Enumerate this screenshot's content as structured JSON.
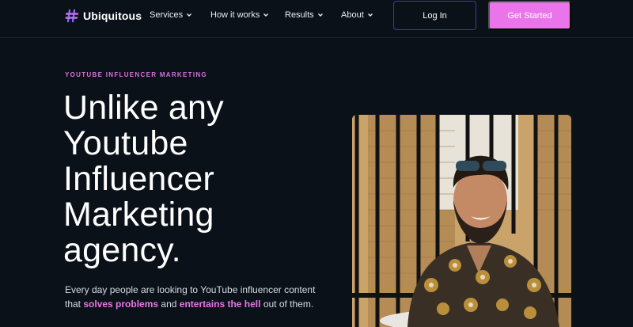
{
  "brand": {
    "name": "Ubiquitous",
    "logo_icon": "hash-icon",
    "accent": "#ea75ea"
  },
  "nav": {
    "items": [
      {
        "label": "Services"
      },
      {
        "label": "How it works"
      },
      {
        "label": "Results"
      },
      {
        "label": "About"
      }
    ],
    "login_label": "Log In",
    "cta_label": "Get Started"
  },
  "hero": {
    "eyebrow": "YOUTUBE INFLUENCER MARKETING",
    "headline": "Unlike any Youtube Influencer Marketing agency.",
    "body_part1": "Every day people are looking to YouTube influencer content that ",
    "body_highlight1": "solves problems",
    "body_part2": " and ",
    "body_highlight2": "entertains the hell",
    "body_part3": " out of them.",
    "image_icon": "influencer-photo"
  },
  "colors": {
    "background": "#0b1118",
    "login_border": "#3a3f9a",
    "cta_background": "#ea75ea",
    "eyebrow": "#d574df"
  }
}
